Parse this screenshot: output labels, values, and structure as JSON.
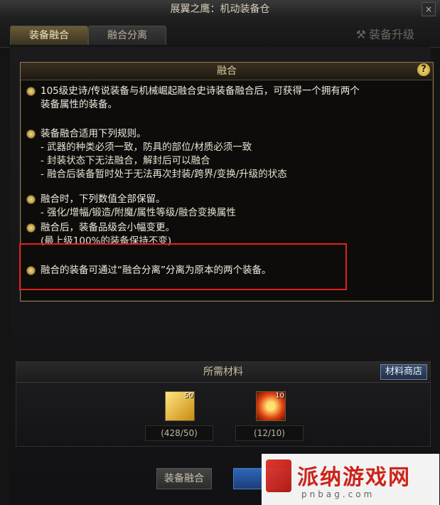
{
  "window": {
    "title": "展翼之鹰：机动装备仓",
    "close_label": "×"
  },
  "tabs": [
    {
      "label": "装备融合",
      "active": true
    },
    {
      "label": "融合分离",
      "active": false
    }
  ],
  "upgrade_label": "装备升级",
  "panel": {
    "title": "融合",
    "help_label": "?",
    "bullets": [
      {
        "lines": [
          "105级史诗/传说装备与机械崛起融合史诗装备融合后，可获得一个拥有两个",
          "装备属性的装备。"
        ]
      },
      {
        "lines": [
          "装备融合适用下列规则。",
          "- 武器的种类必须一致，防具的部位/材质必须一致",
          "- 封装状态下无法融合，解封后可以融合",
          "- 融合后装备暂时处于无法再次封装/跨界/变换/升级的状态"
        ]
      },
      {
        "lines": [
          "融合时，下列数值全部保留。",
          "- 强化/增幅/锻造/附魔/属性等级/融合变换属性"
        ]
      },
      {
        "lines": [
          "融合后，装备品级会小幅变更。",
          "(最上级100%的装备保持不变)"
        ]
      },
      {
        "lines": [
          "融合的装备可通过“融合分离”分离为原本的两个装备。"
        ]
      }
    ]
  },
  "materials": {
    "title": "所需材料",
    "shop_label": "材料商店",
    "items": [
      {
        "icon": "gold-ticket-icon",
        "count": "50",
        "qty": "(428/50)"
      },
      {
        "icon": "fire-orb-icon",
        "count": "10",
        "qty": "(12/10)"
      }
    ]
  },
  "buttons": {
    "fuse_label": "装备融合"
  },
  "watermark": {
    "text": "派纳游戏网",
    "sub": "pnbag.com"
  },
  "colors": {
    "accent_gold": "#d6c89a",
    "highlight_box": "#e02020",
    "shop_blue": "#3a4e6a"
  }
}
